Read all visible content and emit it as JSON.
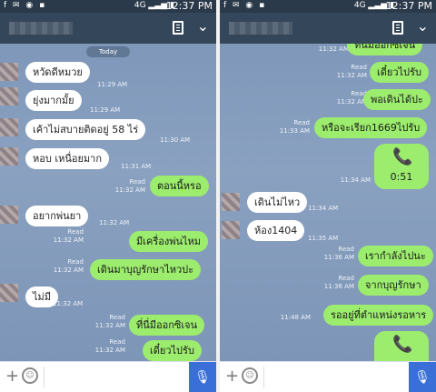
{
  "status": {
    "time": "12:37 PM",
    "left_icons": "f ✉ ◉ ▪",
    "sys": "4G ▂▃▅ ▮"
  },
  "header": {
    "chevron": "⌄"
  },
  "composer": {
    "plus": "+",
    "smile": "☺",
    "mic": "🎙"
  },
  "left": {
    "today_label": "Today",
    "messages": [
      {
        "dir": "in",
        "text": "หวัดดีหมวย",
        "time": "11:29 AM"
      },
      {
        "dir": "in",
        "text": "ยุ่งมากมั้ย",
        "time": "11:29 AM"
      },
      {
        "dir": "in",
        "text": "เค้าไม่สบายติดอยู่ 58 ไร่",
        "time": "11:30 AM"
      },
      {
        "dir": "in",
        "text": "หอบ เหนื่อยมาก",
        "time": "11:31 AM"
      },
      {
        "dir": "out",
        "text": "ตอนนี้หรอ",
        "read": "Read",
        "time": "11:32 AM"
      },
      {
        "dir": "in",
        "text": "อยากพ่นยา",
        "time": "11:32 AM"
      },
      {
        "dir": "out",
        "text": "มีเครื่องพ่นไหม",
        "read": "Read",
        "time": "11:32 AM"
      },
      {
        "dir": "out",
        "text": "เดินมาบุญรักษาไหวปะ",
        "read": "Read",
        "time": "11:32 AM"
      },
      {
        "dir": "in",
        "text": "ไม่มี",
        "time": "11:32 AM"
      },
      {
        "dir": "out",
        "text": "ที่นี่มีออกซิเจน",
        "read": "Read",
        "time": "11:32 AM"
      },
      {
        "dir": "out",
        "text": "เดี๋ยวไปรับ",
        "read": "Read",
        "time": "11:32 AM"
      }
    ]
  },
  "right": {
    "messages": [
      {
        "dir": "out",
        "text": "ที่นี่มีออกซิเจน",
        "read": "",
        "time": "11:32 AM"
      },
      {
        "dir": "out",
        "text": "เดี๋ยวไปรับ",
        "read": "Read",
        "time": "11:32 AM"
      },
      {
        "dir": "out",
        "text": "พอเดินได้ปะ",
        "read": "Read",
        "time": "11:32 AM"
      },
      {
        "dir": "out",
        "text": "หรือจะเรียก1669ไปรับ",
        "read": "Read",
        "time": "11:33 AM"
      },
      {
        "dir": "out",
        "text": "0:51",
        "read": "",
        "time": "11:34 AM",
        "type": "call"
      },
      {
        "dir": "in",
        "text": "เดินไม่ไหว",
        "time": "11:34 AM"
      },
      {
        "dir": "in",
        "text": "ห้อง1404",
        "time": "11:35 AM"
      },
      {
        "dir": "out",
        "text": "เรากำลังไปนะ",
        "read": "Read",
        "time": "11:36 AM"
      },
      {
        "dir": "out",
        "text": "จากบุญรักษา",
        "read": "Read",
        "time": "11:36 AM"
      },
      {
        "dir": "out",
        "text": "รออยู่ที่ตำแหน่งรอหาร",
        "read": "",
        "time": "11:48 AM"
      }
    ]
  },
  "icons": {
    "phone": "📞",
    "call_card_icon": "phone-call-icon"
  }
}
